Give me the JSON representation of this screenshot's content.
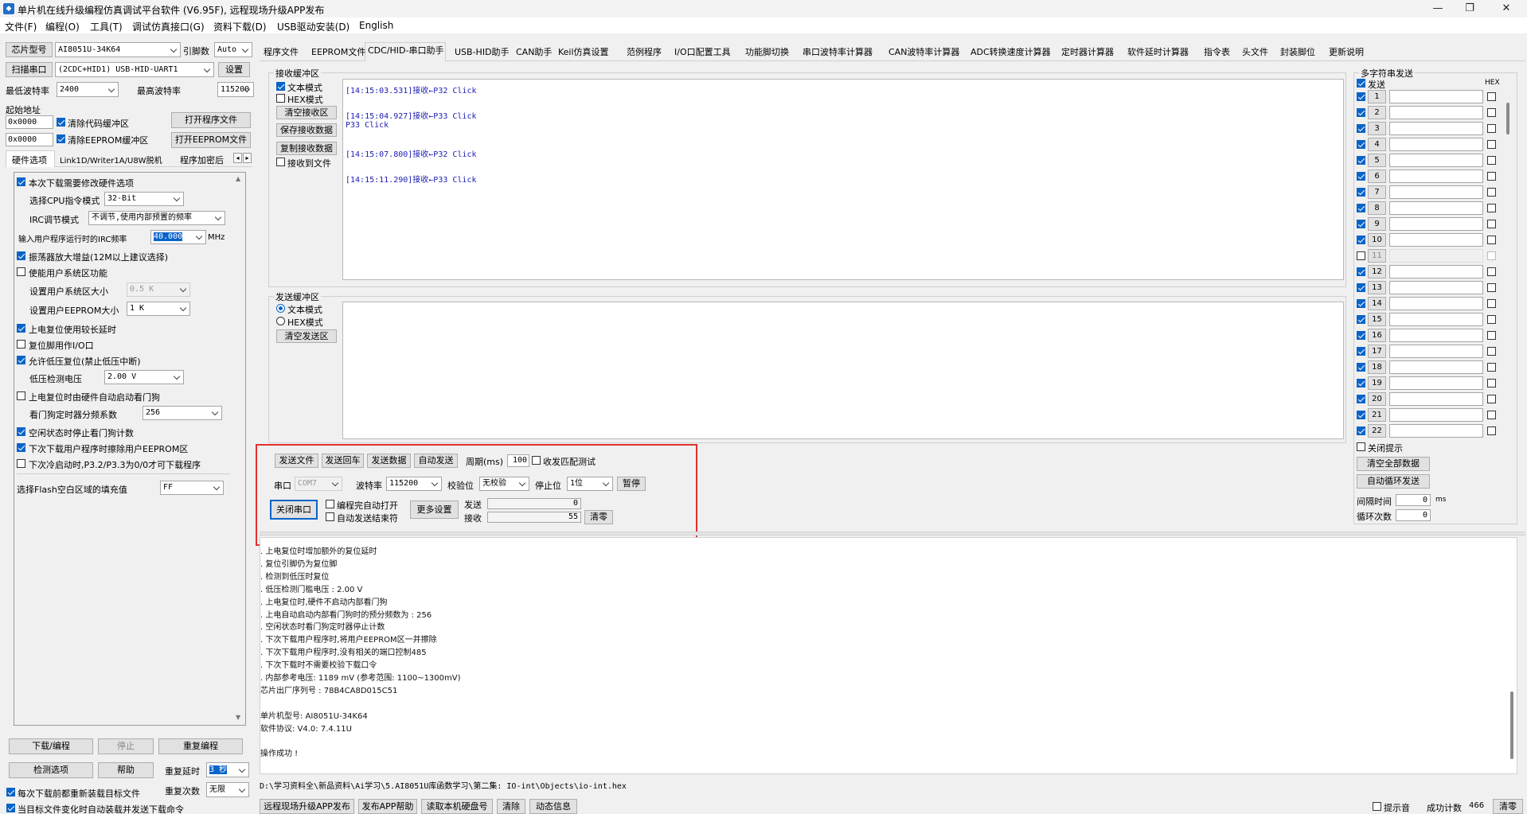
{
  "window": {
    "title": "单片机在线升级编程仿真调试平台软件 (V6.95F), 远程现场升级APP发布",
    "min": "—",
    "max": "❐",
    "close": "✕"
  },
  "menu": [
    "文件(F)",
    "编程(O)",
    "工具(T)",
    "调试仿真接口(G)",
    "资料下载(D)",
    "USB驱动安装(D)",
    "English"
  ],
  "left": {
    "chip_label": "芯片型号",
    "chip_value": "AI8051U-34K64",
    "pin_label": "引脚数",
    "pin_value": "Auto",
    "scan_btn": "扫描串口",
    "port_value": "(2CDC+HID1) USB-HID-UART1",
    "settings_btn": "设置",
    "min_baud_label": "最低波特率",
    "min_baud": "2400",
    "max_baud_label": "最高波特率",
    "max_baud": "115200",
    "start_addr_label": "起始地址",
    "addr1": "0x0000",
    "clear_code_buf": "清除代码缓冲区",
    "open_prog_btn": "打开程序文件",
    "addr2": "0x0000",
    "clear_eeprom_buf": "清除EEPROM缓冲区",
    "open_eeprom_btn": "打开EEPROM文件",
    "tabs": [
      "硬件选项",
      "Link1D/Writer1A/U8W脱机",
      "程序加密后"
    ],
    "hw": {
      "opt1": "本次下载需要修改硬件选项",
      "cpu_mode_label": "选择CPU指令模式",
      "cpu_mode": "32-Bit",
      "irc_label": "IRC调节模式",
      "irc_value": "不调节,使用内部预置的频率",
      "freq_label": "输入用户程序运行时的IRC频率",
      "freq_value": "40.000",
      "freq_unit": "MHz",
      "opt2": "振荡器放大增益(12M以上建议选择)",
      "opt3": "使能用户系统区功能",
      "sys_size_label": "设置用户系统区大小",
      "sys_size": "0.5 K",
      "eeprom_size_label": "设置用户EEPROM大小",
      "eeprom_size": "1   K",
      "opt4": "上电复位使用较长延时",
      "opt5": "复位脚用作I/O口",
      "opt6": "允许低压复位(禁止低压中断)",
      "lvd_label": "低压检测电压",
      "lvd_value": "2.00 V",
      "opt7": "上电复位时由硬件自动启动看门狗",
      "wdt_label": "看门狗定时器分频系数",
      "wdt_value": "256",
      "opt8": "空闲状态时停止看门狗计数",
      "opt9": "下次下载用户程序时擦除用户EEPROM区",
      "opt10": "下次冷启动时,P3.2/P3.3为0/0才可下载程序",
      "fill_label": "选择Flash空白区域的填充值",
      "fill_value": "FF"
    },
    "download_btn": "下载/编程",
    "stop_btn": "停止",
    "reprog_btn": "重复编程",
    "check_btn": "检测选项",
    "help_btn": "帮助",
    "repeat_delay_label": "重复延时",
    "repeat_delay": "3 秒",
    "repeat_count_label": "重复次数",
    "repeat_count": "无限",
    "chk_reload": "每次下载前都重新装载目标文件",
    "chk_autoload": "当目标文件变化时自动装载并发送下载命令"
  },
  "main_tabs": [
    "程序文件",
    "EEPROM文件",
    "CDC/HID-串口助手",
    "USB-HID助手",
    "CAN助手",
    "Keil仿真设置",
    "范例程序",
    "I/O口配置工具",
    "功能脚切换",
    "串口波特率计算器",
    "CAN波特率计算器",
    "ADC转换速度计算器",
    "定时器计算器",
    "软件延时计算器",
    "指令表",
    "头文件",
    "封装脚位",
    "更新说明"
  ],
  "recv": {
    "title": "接收缓冲区",
    "text_mode": "文本模式",
    "hex_mode": "HEX模式",
    "clear_btn": "清空接收区",
    "save_btn": "保存接收数据",
    "copy_btn": "复制接收数据",
    "to_file": "接收到文件",
    "lines": [
      "[14:15:03.531]接收←P32 Click",
      "[14:15:04.927]接收←P33 Click",
      "P33 Click",
      "[14:15:07.800]接收←P32 Click",
      "[14:15:11.290]接收←P33 Click"
    ]
  },
  "send": {
    "title": "发送缓冲区",
    "text_mode": "文本模式",
    "hex_mode": "HEX模式",
    "clear_btn": "清空发送区"
  },
  "serial": {
    "send_file": "发送文件",
    "send_return": "发送回车",
    "send_data": "发送数据",
    "auto_send": "自动发送",
    "period_label": "周期(ms)",
    "period": "100",
    "match_test": "收发匹配测试",
    "port_label": "串口",
    "port": "COM7",
    "baud_label": "波特率",
    "baud": "115200",
    "parity_label": "校验位",
    "parity": "无校验",
    "stop_label": "停止位",
    "stop": "1位",
    "pause_btn": "暂停",
    "close_btn": "关闭串口",
    "auto_open": "编程完自动打开",
    "auto_end": "自动发送结束符",
    "more_btn": "更多设置",
    "tx_label": "发送",
    "tx_count": "0",
    "rx_label": "接收",
    "rx_count": "55",
    "reset_btn": "清零"
  },
  "multi": {
    "title": "多字符串发送",
    "send_label": "发送",
    "hex_label": "HEX",
    "rows": [
      "1",
      "2",
      "3",
      "4",
      "5",
      "6",
      "7",
      "8",
      "9",
      "10",
      "11",
      "12",
      "13",
      "14",
      "15",
      "16",
      "17",
      "18",
      "19",
      "20",
      "21",
      "22"
    ],
    "close_hint": "关闭提示",
    "clear_all": "清空全部数据",
    "auto_loop": "自动循环发送",
    "interval_label": "间隔时间",
    "interval": "0",
    "interval_unit": "ms",
    "loop_label": "循环次数",
    "loop": "0"
  },
  "log": {
    "lines": [
      "  . 上电复位时增加额外的复位延时",
      "  . 复位引脚仍为复位脚",
      "  . 检测到低压时复位",
      "  . 低压检测门槛电压 : 2.00 V",
      "  . 上电复位时,硬件不启动内部看门狗",
      "  . 上电自动启动内部看门狗时的预分频数为 : 256",
      "  . 空闲状态时看门狗定时器停止计数",
      "  . 下次下载用户程序时,将用户EEPROM区一并擦除",
      "  . 下次下载用户程序时,没有相关的端口控制485",
      "  . 下次下载时不需要校验下载口令",
      "  . 内部参考电压: 1189 mV (参考范围: 1100~1300mV)",
      "芯片出厂序列号 : 78B4CA8D015C51",
      "",
      "  单片机型号: AI8051U-34K64",
      "  软件协议: V4.0: 7.4.11U",
      "",
      "操作成功 !"
    ]
  },
  "filepath": "D:\\学习资料全\\新品资料\\Ai学习\\5.AI8051U库函数学习\\第二集: IO-int\\Objects\\io-int.hex",
  "bottom": {
    "remote_btn": "远程现场升级APP发布",
    "app_help": "发布APP帮助",
    "read_hdd": "读取本机硬盘号",
    "clear_btn": "清除",
    "dyn_info": "动态信息",
    "beep": "提示音",
    "success_label": "成功计数",
    "success_count": "466",
    "clear2": "清零"
  }
}
